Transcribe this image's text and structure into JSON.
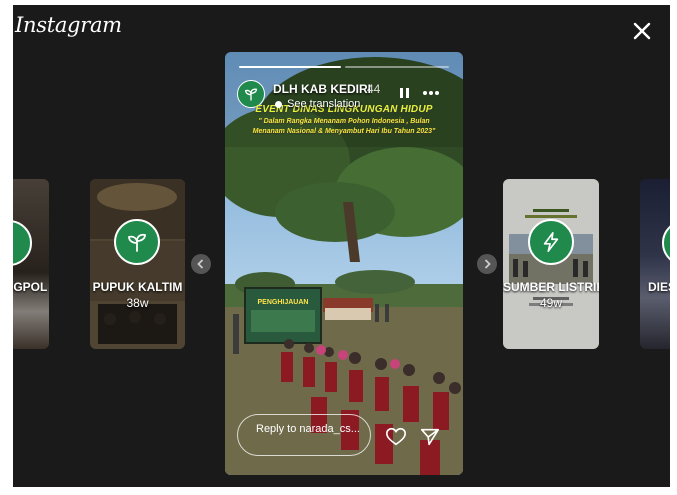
{
  "app": {
    "logo": "Instagram"
  },
  "stories": {
    "left_far": {
      "name": "NGPOL"
    },
    "left": {
      "name": "PUPUK KALTIM",
      "time": "38w"
    },
    "right": {
      "name": "SUMBER LISTRIK",
      "time": "49w"
    },
    "right_far": {
      "name": "DIES"
    }
  },
  "current": {
    "account": "DLH KAB KEDIRI",
    "time": "44",
    "translate_label": "See translation",
    "event_title": "EVENT DINAS LINGKUNGAN HIDUP",
    "event_sub1": "\" Dalam Rangka Menanam Pohon Indonesia , Bulan",
    "event_sub2": "Menanam Nasional & Menyambut Hari Ibu Tahun 2023\"",
    "banner_text": "PENGHIJAUAN",
    "reply_placeholder": "Reply to narada_cs..."
  },
  "icons": [
    "close-icon",
    "pause-icon",
    "more-icon",
    "heart-icon",
    "send-icon",
    "chevron-left-icon",
    "chevron-right-icon",
    "sprout-icon",
    "lightning-icon"
  ],
  "colors": {
    "background": "#1a1a1a",
    "avatar": "#1f8a4c",
    "title": "#e6f23a"
  }
}
